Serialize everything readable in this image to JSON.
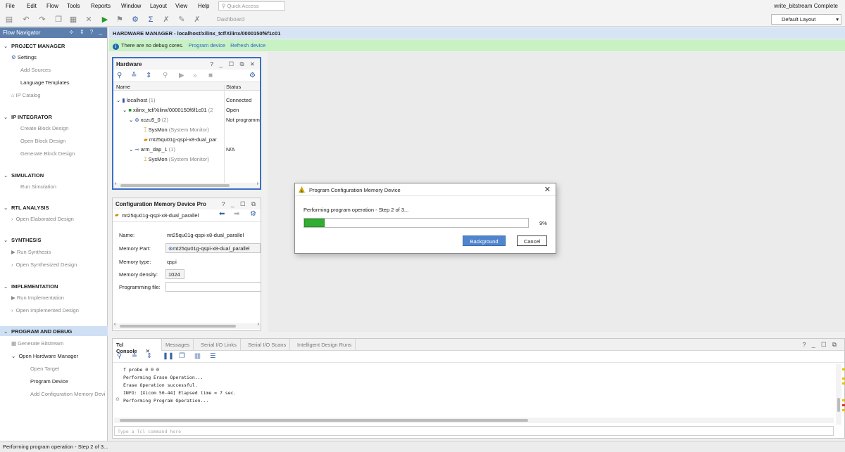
{
  "menubar": {
    "items": [
      "File",
      "Edit",
      "Flow",
      "Tools",
      "Reports",
      "Window",
      "Layout",
      "View",
      "Help"
    ],
    "quick_access_placeholder": "Quick Access",
    "status_right": "write_bitstream Complete"
  },
  "toolbar": {
    "dashboard_label": "Dashboard",
    "layout_selected": "Default Layout"
  },
  "flow_navigator": {
    "title": "Flow Navigator",
    "sections": {
      "project_manager": "PROJECT MANAGER",
      "settings": "Settings",
      "add_sources": "Add Sources",
      "language_templates": "Language Templates",
      "ip_catalog": "IP Catalog",
      "ip_integrator": "IP INTEGRATOR",
      "create_block_design": "Create Block Design",
      "open_block_design": "Open Block Design",
      "generate_block_design": "Generate Block Design",
      "simulation": "SIMULATION",
      "run_simulation": "Run Simulation",
      "rtl_analysis": "RTL ANALYSIS",
      "open_elaborated_design": "Open Elaborated Design",
      "synthesis": "SYNTHESIS",
      "run_synthesis": "Run Synthesis",
      "open_synthesized_design": "Open Synthesized Design",
      "implementation": "IMPLEMENTATION",
      "run_implementation": "Run Implementation",
      "open_implemented_design": "Open Implemented Design",
      "program_and_debug": "PROGRAM AND DEBUG",
      "generate_bitstream": "Generate Bitstream",
      "open_hardware_manager": "Open Hardware Manager",
      "open_target": "Open Target",
      "program_device": "Program Device",
      "add_configuration_memory_device": "Add Configuration Memory Devi"
    }
  },
  "hardware_manager": {
    "header": "HARDWARE MANAGER - localhost/xilinx_tcf/Xilinx/0000150f6f1c01",
    "info": "There are no debug cores.",
    "program_device_link": "Program device",
    "refresh_device_link": "Refresh device"
  },
  "hardware_panel": {
    "title": "Hardware",
    "col_name": "Name",
    "col_status": "Status",
    "rows": [
      {
        "name": "localhost",
        "count": "(1)",
        "status": "Connected"
      },
      {
        "name": "xilinx_tcf/Xilinx/0000150f6f1c01",
        "count": "(2",
        "status": "Open"
      },
      {
        "name": "xczu5_0",
        "count": "(2)",
        "status": "Not programm"
      },
      {
        "name": "SysMon",
        "count": "(System Monitor)",
        "status": ""
      },
      {
        "name": "mt25qu01g-qspi-x8-dual_par",
        "count": "",
        "status": ""
      },
      {
        "name": "arm_dap_1",
        "count": "(1)",
        "status": "N/A"
      },
      {
        "name": "SysMon",
        "count": "(System Monitor)",
        "status": ""
      }
    ]
  },
  "config_panel": {
    "title": "Configuration Memory Device Pro",
    "device": "mt25qu01g-qspi-x8-dual_parallel",
    "name_label": "Name:",
    "name_value": "mt25qu01g-qspi-x8-dual_parallel",
    "memory_part_label": "Memory Part:",
    "memory_part_value": "mt25qu01g-qspi-x8-dual_parallel",
    "memory_type_label": "Memory type:",
    "memory_type_value": "qspi",
    "memory_density_label": "Memory density:",
    "memory_density_value": "1024",
    "programming_file_label": "Programming file:",
    "programming_file_value": ""
  },
  "dialog": {
    "title": "Program Configuration Memory Device",
    "message": "Performing program operation - Step 2 of 3...",
    "progress_percent": 9,
    "progress_label": "9%",
    "background_button": "Background",
    "cancel_button": "Cancel"
  },
  "console": {
    "tabs": [
      "Tcl Console",
      "Messages",
      "Serial I/O Links",
      "Serial I/O Scans",
      "Intelligent Design Runs"
    ],
    "lines": [
      "f probe 0 0 0",
      "Performing Erase Operation...",
      "Erase Operation successful.",
      "INFO: [Xicom 50-44] Elapsed time = 7 sec.",
      "Performing Program Operation..."
    ],
    "input_placeholder": "Type a Tcl command here"
  },
  "statusbar": {
    "text": "Performing program operation - Step 2 of 3..."
  },
  "colors": {
    "accent": "#5d7fae",
    "info_bg": "#c8f1c4",
    "progress": "#2fae2f",
    "primary_button": "#4f85cc"
  }
}
